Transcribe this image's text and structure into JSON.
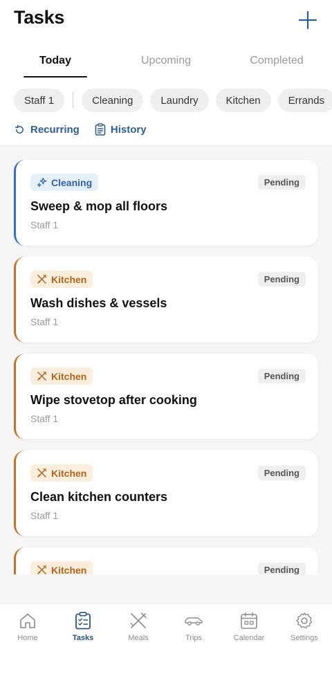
{
  "header": {
    "title": "Tasks",
    "add_icon": "plus-icon"
  },
  "tabs": [
    {
      "label": "Today",
      "active": true
    },
    {
      "label": "Upcoming",
      "active": false
    },
    {
      "label": "Completed",
      "active": false
    }
  ],
  "filters": {
    "staff": "Staff 1",
    "categories": [
      "Cleaning",
      "Laundry",
      "Kitchen",
      "Errands"
    ]
  },
  "links": {
    "recurring": {
      "label": "Recurring",
      "icon": "refresh-icon"
    },
    "history": {
      "label": "History",
      "icon": "clipboard-icon"
    }
  },
  "tasks": [
    {
      "category": "Cleaning",
      "category_icon": "sparkles-icon",
      "status": "Pending",
      "title": "Sweep & mop all floors",
      "assignee": "Staff 1"
    },
    {
      "category": "Kitchen",
      "category_icon": "utensils-icon",
      "status": "Pending",
      "title": "Wash dishes & vessels",
      "assignee": "Staff 1"
    },
    {
      "category": "Kitchen",
      "category_icon": "utensils-icon",
      "status": "Pending",
      "title": "Wipe stovetop after cooking",
      "assignee": "Staff 1"
    },
    {
      "category": "Kitchen",
      "category_icon": "utensils-icon",
      "status": "Pending",
      "title": "Clean kitchen counters",
      "assignee": "Staff 1"
    },
    {
      "category": "Kitchen",
      "category_icon": "utensils-icon",
      "status": "Pending",
      "title": "",
      "assignee": ""
    }
  ],
  "nav": [
    {
      "label": "Home",
      "icon": "home-icon",
      "active": false
    },
    {
      "label": "Tasks",
      "icon": "clipboard-check-icon",
      "active": true
    },
    {
      "label": "Meals",
      "icon": "utensils-icon",
      "active": false
    },
    {
      "label": "Trips",
      "icon": "car-icon",
      "active": false
    },
    {
      "label": "Calendar",
      "icon": "calendar-icon",
      "active": false
    },
    {
      "label": "Settings",
      "icon": "gear-icon",
      "active": false
    }
  ],
  "colors": {
    "accent": "#2c5282",
    "cleaning": "#3a6fc0",
    "kitchen": "#c0722a"
  }
}
